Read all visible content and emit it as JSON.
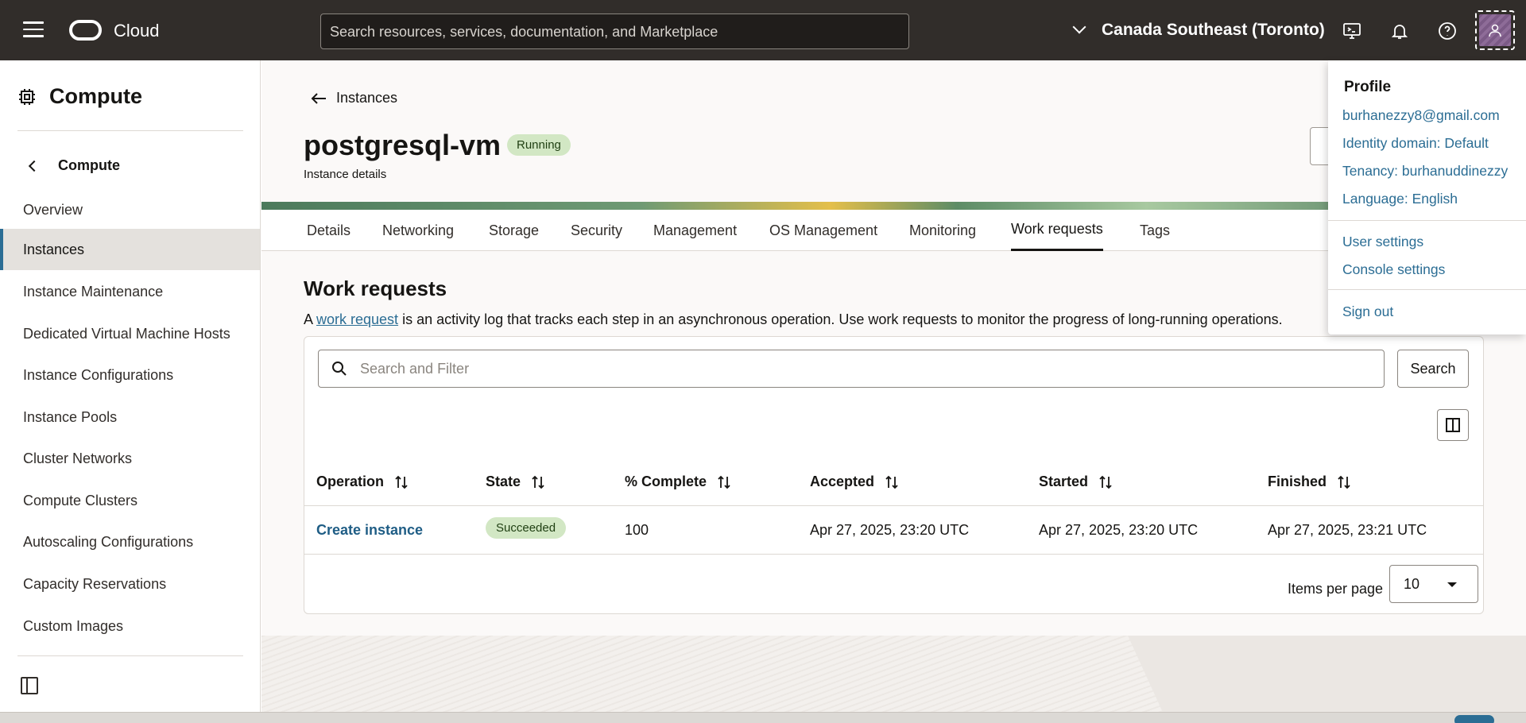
{
  "topbar": {
    "brand": "Cloud",
    "search_placeholder": "Search resources, services, documentation, and Marketplace",
    "region": "Canada Southeast (Toronto)",
    "icons": [
      "menu-icon",
      "oracle-logo",
      "chevron-down-icon",
      "cloud-shell-icon",
      "bell-icon",
      "help-icon",
      "user-avatar-icon"
    ]
  },
  "sidebar": {
    "title": "Compute",
    "back_label": "Compute",
    "items": [
      {
        "label": "Overview",
        "active": false
      },
      {
        "label": "Instances",
        "active": true
      },
      {
        "label": "Instance Maintenance",
        "active": false
      },
      {
        "label": "Dedicated Virtual Machine Hosts",
        "active": false
      },
      {
        "label": "Instance Configurations",
        "active": false
      },
      {
        "label": "Instance Pools",
        "active": false
      },
      {
        "label": "Cluster Networks",
        "active": false
      },
      {
        "label": "Compute Clusters",
        "active": false
      },
      {
        "label": "Autoscaling Configurations",
        "active": false
      },
      {
        "label": "Capacity Reservations",
        "active": false
      },
      {
        "label": "Custom Images",
        "active": false
      }
    ]
  },
  "main": {
    "breadcrumb": "Instances",
    "title": "postgresql-vm",
    "status": "Running",
    "subtitle": "Instance details",
    "tabs": [
      "Details",
      "Networking",
      "Storage",
      "Security",
      "Management",
      "OS Management",
      "Monitoring",
      "Work requests",
      "Tags"
    ],
    "active_tab": "Work requests",
    "section_title": "Work requests",
    "desc_prefix": "A ",
    "desc_link": "work request",
    "desc_suffix": " is an activity log that tracks each step in an asynchronous operation. Use work requests to monitor the progress of long-running operations.",
    "filter_placeholder": "Search and Filter",
    "search_button": "Search",
    "table": {
      "headers": [
        "Operation",
        "State",
        "% Complete",
        "Accepted",
        "Started",
        "Finished"
      ],
      "rows": [
        {
          "operation": "Create instance",
          "state": "Succeeded",
          "complete": "100",
          "accepted": "Apr 27, 2025, 23:20 UTC",
          "started": "Apr 27, 2025, 23:20 UTC",
          "finished": "Apr 27, 2025, 23:21 UTC"
        }
      ]
    },
    "items_per_page_label": "Items per page",
    "items_per_page": "10"
  },
  "profile_menu": {
    "title": "Profile",
    "email": "burhanezzy8@gmail.com",
    "identity_domain": "Identity domain: Default",
    "tenancy": "Tenancy: burhanuddinezzy",
    "language": "Language: English",
    "user_settings": "User settings",
    "console_settings": "Console settings",
    "sign_out": "Sign out"
  },
  "colors": {
    "topbar": "#312d2a",
    "link": "#2b6d94",
    "success_badge": "#d2e7c4",
    "active_nav_border": "#2b6d94"
  }
}
